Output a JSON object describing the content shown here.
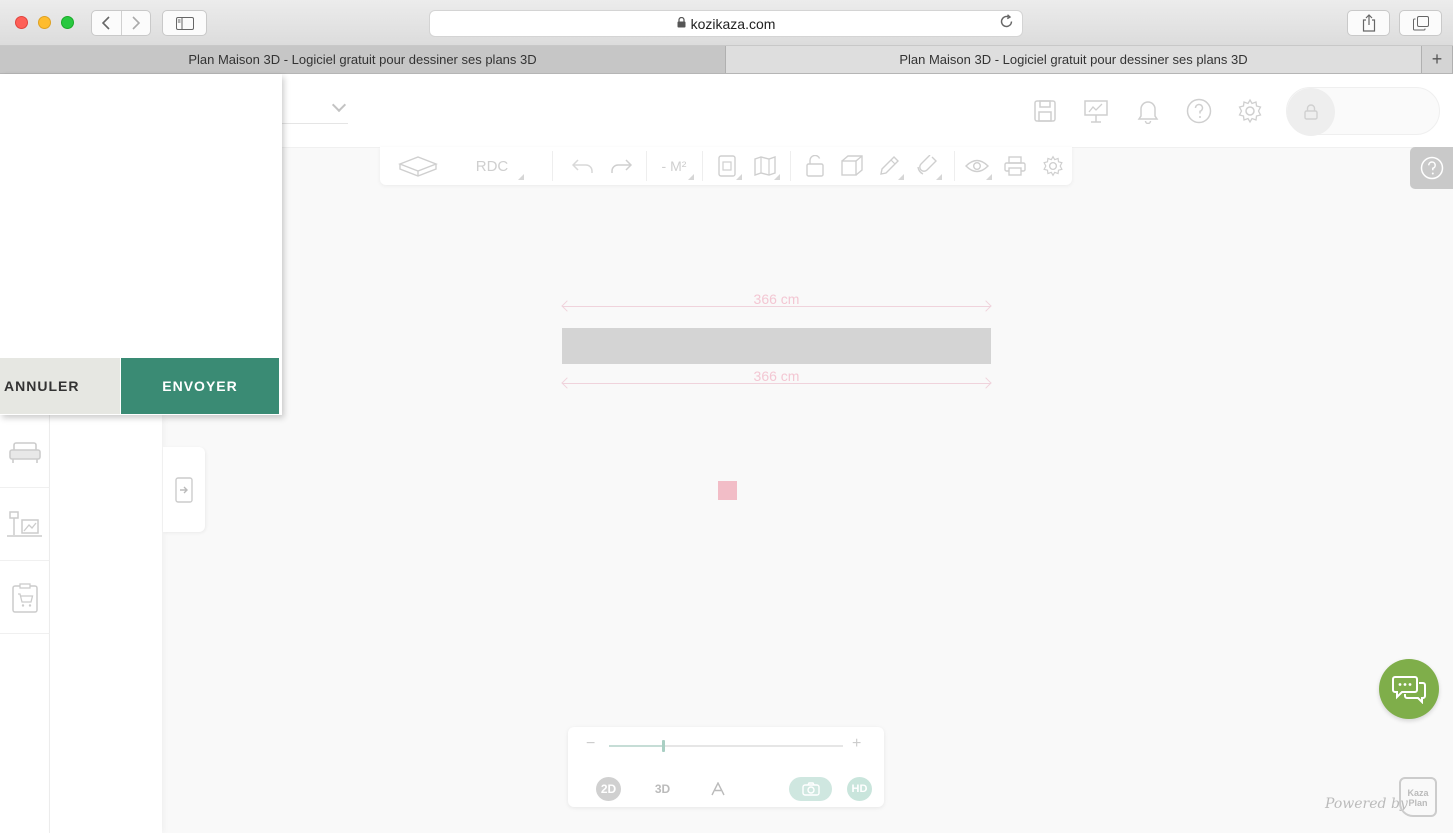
{
  "browser": {
    "url": "kozikaza.com",
    "tabs": [
      {
        "label": "Plan Maison 3D - Logiciel gratuit pour dessiner ses plans 3D"
      },
      {
        "label": "Plan Maison 3D - Logiciel gratuit pour dessiner ses plans 3D"
      }
    ],
    "new_tab_label": "+"
  },
  "toolbar": {
    "level_label": "RDC",
    "area_label": "- M²"
  },
  "canvas": {
    "dimension_top": "366 cm",
    "dimension_bottom": "366 cm"
  },
  "modal": {
    "cancel_label": "ANNULER",
    "send_label": "ENVOYER"
  },
  "view_controls": {
    "mode_2d": "2D",
    "mode_3d": "3D",
    "hd_label": "HD",
    "zoom_minus": "−",
    "zoom_plus": "+",
    "zoom_level_fraction": 0.23
  },
  "branding": {
    "powered_by": "Powered by",
    "logo_text": "Kaza Plan"
  },
  "colors": {
    "accent_green": "#3a8b74",
    "chat_green": "#7fae4a",
    "wall_gray": "#d4d4d4",
    "dimension_pink": "#f3c7d3"
  }
}
